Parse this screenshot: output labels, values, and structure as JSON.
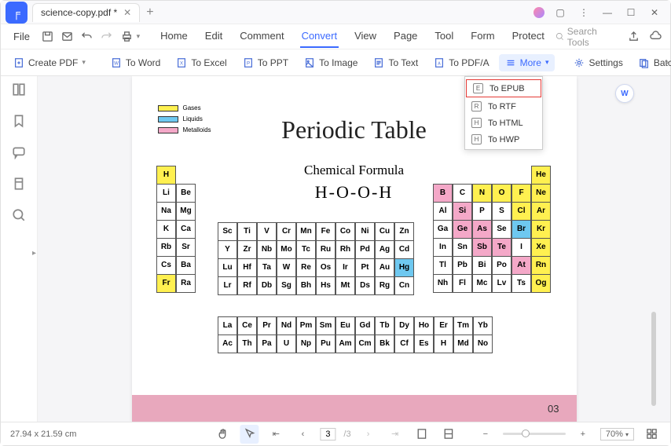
{
  "tab": {
    "title": "science-copy.pdf *"
  },
  "menu": {
    "file": "File",
    "tabs": [
      "Home",
      "Edit",
      "Comment",
      "Convert",
      "View",
      "Page",
      "Tool",
      "Form",
      "Protect"
    ],
    "active": "Convert",
    "search_placeholder": "Search Tools"
  },
  "ribbon": {
    "create": "Create PDF",
    "word": "To Word",
    "excel": "To Excel",
    "ppt": "To PPT",
    "image": "To Image",
    "text": "To Text",
    "pdfa": "To PDF/A",
    "more": "More",
    "settings": "Settings",
    "batch": "Batch Conve"
  },
  "dropdown": {
    "epub": "To EPUB",
    "rtf": "To RTF",
    "html": "To HTML",
    "hwp": "To HWP"
  },
  "doc": {
    "title": "Periodic Table",
    "subtitle": "Chemical Formula",
    "formula": "H-O-O-H",
    "legend": {
      "gases": "Gases",
      "liquids": "Liquids",
      "metalloids": "Metalloids"
    },
    "page_num": "03",
    "left_block": [
      [
        "H",
        ""
      ],
      [
        "Li",
        "Be"
      ],
      [
        "Na",
        "Mg"
      ],
      [
        "K",
        "Ca"
      ],
      [
        "Rb",
        "Sr"
      ],
      [
        "Cs",
        "Ba"
      ],
      [
        "Fr",
        "Ra"
      ]
    ],
    "left_colors": {
      "H": "y",
      "Fr": "y"
    },
    "mid_block": [
      [
        "Sc",
        "Ti",
        "V",
        "Cr",
        "Mn",
        "Fe",
        "Co",
        "Ni",
        "Cu",
        "Zn"
      ],
      [
        "Y",
        "Zr",
        "Nb",
        "Mo",
        "Tc",
        "Ru",
        "Rh",
        "Pd",
        "Ag",
        "Cd"
      ],
      [
        "Lu",
        "Hf",
        "Ta",
        "W",
        "Re",
        "Os",
        "Ir",
        "Pt",
        "Au",
        "Hg"
      ],
      [
        "Lr",
        "Rf",
        "Db",
        "Sg",
        "Bh",
        "Hs",
        "Mt",
        "Ds",
        "Rg",
        "Cn"
      ]
    ],
    "mid_colors": {
      "Hg": "b"
    },
    "right_block": [
      [
        "",
        "",
        "",
        "",
        "",
        "He"
      ],
      [
        "B",
        "C",
        "N",
        "O",
        "F",
        "Ne"
      ],
      [
        "Al",
        "Si",
        "P",
        "S",
        "Cl",
        "Ar"
      ],
      [
        "Ga",
        "Ge",
        "As",
        "Se",
        "Br",
        "Kr"
      ],
      [
        "In",
        "Sn",
        "Sb",
        "Te",
        "I",
        "Xe"
      ],
      [
        "Tl",
        "Pb",
        "Bi",
        "Po",
        "At",
        "Rn"
      ],
      [
        "Nh",
        "Fl",
        "Mc",
        "Lv",
        "Ts",
        "Og"
      ]
    ],
    "right_colors": {
      "He": "y",
      "B": "p",
      "N": "y",
      "O": "y",
      "F": "y",
      "Ne": "y",
      "Si": "p",
      "Cl": "y",
      "Ar": "y",
      "Ge": "p",
      "As": "p",
      "Br": "b",
      "Kr": "y",
      "Sb": "p",
      "Te": "p",
      "Xe": "y",
      "At": "p",
      "Rn": "y",
      "Og": "y"
    },
    "bottom_block": [
      [
        "La",
        "Ce",
        "Pr",
        "Nd",
        "Pm",
        "Sm",
        "Eu",
        "Gd",
        "Tb",
        "Dy",
        "Ho",
        "Er",
        "Tm",
        "Yb"
      ],
      [
        "Ac",
        "Th",
        "Pa",
        "U",
        "Np",
        "Pu",
        "Am",
        "Cm",
        "Bk",
        "Cf",
        "Es",
        "H",
        "Md",
        "No"
      ]
    ]
  },
  "status": {
    "dims": "27.94 x 21.59 cm",
    "page": "3",
    "total": "/3",
    "zoom": "70%"
  },
  "badge": "W"
}
